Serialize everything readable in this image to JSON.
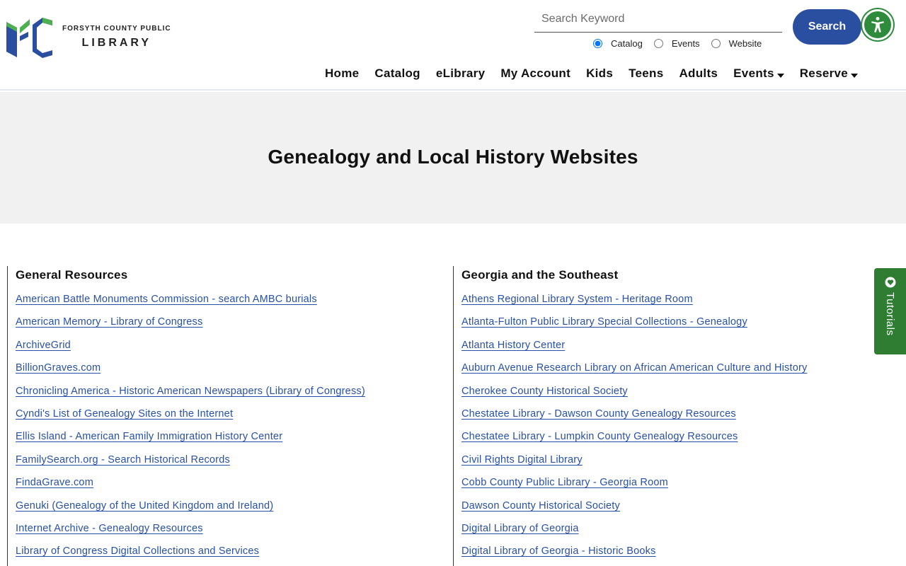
{
  "logo": {
    "line1": "FORSYTH COUNTY PUBLIC",
    "line2": "LIBRARY"
  },
  "search": {
    "placeholder": "Search Keyword",
    "button_label": "Search",
    "options": [
      "Catalog",
      "Events",
      "Website"
    ],
    "selected": "Catalog"
  },
  "nav": {
    "items": [
      {
        "label": "Home"
      },
      {
        "label": "Catalog"
      },
      {
        "label": "eLibrary"
      },
      {
        "label": "My Account"
      },
      {
        "label": "Kids"
      },
      {
        "label": "Teens"
      },
      {
        "label": "Adults"
      },
      {
        "label": "Events"
      },
      {
        "label": "Reserve"
      }
    ]
  },
  "page": {
    "title": "Genealogy and Local History Websites"
  },
  "general": {
    "heading": "General Resources",
    "links": [
      "American Battle Monuments Commission - search AMBC burials",
      "American Memory - Library of Congress",
      "ArchiveGrid",
      "BillionGraves.com",
      "Chronicling America - Historic American Newspapers (Library of Congress)",
      "Cyndi's List of Genealogy Sites on the Internet",
      "Ellis Island - American Family Immigration History Center",
      "FamilySearch.org - Search Historical Records",
      "FindaGrave.com",
      "Genuki (Genealogy of the United Kingdom and Ireland)",
      "Internet Archive - Genealogy Resources",
      "Library of Congress Digital Collections and Services"
    ]
  },
  "georgia": {
    "heading": "Georgia and the Southeast",
    "links": [
      "Athens Regional Library System - Heritage Room",
      "Atlanta-Fulton Public Library Special Collections - Genealogy",
      "Atlanta History Center",
      "Auburn Avenue Research Library on African American Culture and History",
      "Cherokee County Historical Society",
      "Chestatee Library - Dawson County Genealogy Resources",
      "Chestatee Library - Lumpkin County Genealogy Resources",
      "Civil Rights Digital Library",
      "Cobb County Public Library - Georgia Room",
      "Dawson County Historical Society",
      "Digital Library of Georgia",
      "Digital Library of Georgia - Historic Books"
    ]
  },
  "tutorials": {
    "label": "Tutorials"
  },
  "colors": {
    "brand_blue": "#2a4ea0",
    "link": "#2850a8",
    "green": "#2e7d32"
  }
}
